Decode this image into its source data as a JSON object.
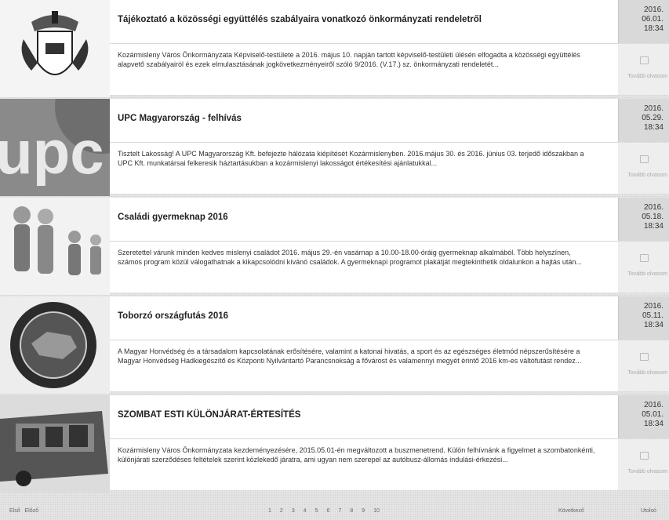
{
  "items": [
    {
      "title": "Tájékoztató a közösségi együttélés szabályaira vonatkozó önkormányzati rendeletről",
      "date": [
        "2016.",
        "06.01.",
        "18:34"
      ],
      "excerpt": "Kozármisleny Város Önkormányzata Képviselő-testülete a 2016. május 10. napján tartott képviselő-testületi ülésén elfogadta a közösségi együttélés alapvető szabályairól és ezek elmulasztásának jogkövetkezményeiről szóló 9/2016. (V.17.) sz. önkormányzati rendeletét...",
      "more": "Tovább olvasom"
    },
    {
      "title": "UPC Magyarország - felhívás",
      "date": [
        "2016.",
        "05.29.",
        "18:34"
      ],
      "excerpt": "Tisztelt Lakosság! A UPC Magyarország Kft. befejezte hálózata kiépítését Kozármislenyben. 2016.május 30. és 2016. június 03. terjedő időszakban a UPC Kft. munkatársai felkeresik háztartásukban a kozármislenyi lakosságot értékesítési ajánlatukkal...",
      "more": "Tovább olvasom"
    },
    {
      "title": "Családi gyermeknap 2016",
      "date": [
        "2016.",
        "05.18.",
        "18:34"
      ],
      "excerpt": "Szeretettel várunk minden kedves mislenyi családot 2016. május 29.-én vasárnap a 10.00-18.00-óráig gyermeknap alkalmából. Több helyszínen, számos program közül válogathatnak a kikapcsolódni kívánó családok. A gyermeknapi programot plakátját megtekinthetik oldalunkon a hajtás után...",
      "more": "Tovább olvasom"
    },
    {
      "title": "Toborzó országfutás 2016",
      "date": [
        "2016.",
        "05.11.",
        "18:34"
      ],
      "excerpt": "A Magyar Honvédség és a társadalom kapcsolatának erősítésére, valamint a katonai hivatás, a sport és az egészséges életmód népszerűsítésére a Magyar Honvédség Hadkiegészítő és Központi Nyilvántartó Parancsnokság a fővárost és valamennyi megyét érintő 2016 km-es váltófutást rendez...",
      "more": "Tovább olvasom"
    },
    {
      "title": "SZOMBAT ESTI KÜLÖNJÁRAT-ÉRTESÍTÉS",
      "date": [
        "2016.",
        "05.01.",
        "18:34"
      ],
      "excerpt": "Kozármisleny Város Önkormányzata kezdeményezésére, 2015.05.01-én megváltozott a buszmenetrend. Külön felhívnánk a figyelmet a szombatonkénti, különjárati szerződéses feltételek szerint közlekedő járatra, ami ugyan nem szerepel az autóbusz-állomás indulási-érkezési...",
      "more": "Tovább olvasom"
    }
  ],
  "pagination": {
    "first": "Első",
    "prev": "Előző",
    "pages": [
      "1",
      "2",
      "3",
      "4",
      "5",
      "6",
      "7",
      "8",
      "9",
      "10"
    ],
    "next": "Következő",
    "last": "Utolsó"
  },
  "colors": {
    "date_bg": "#d9d9d9",
    "accent": "#4a8fb5"
  }
}
